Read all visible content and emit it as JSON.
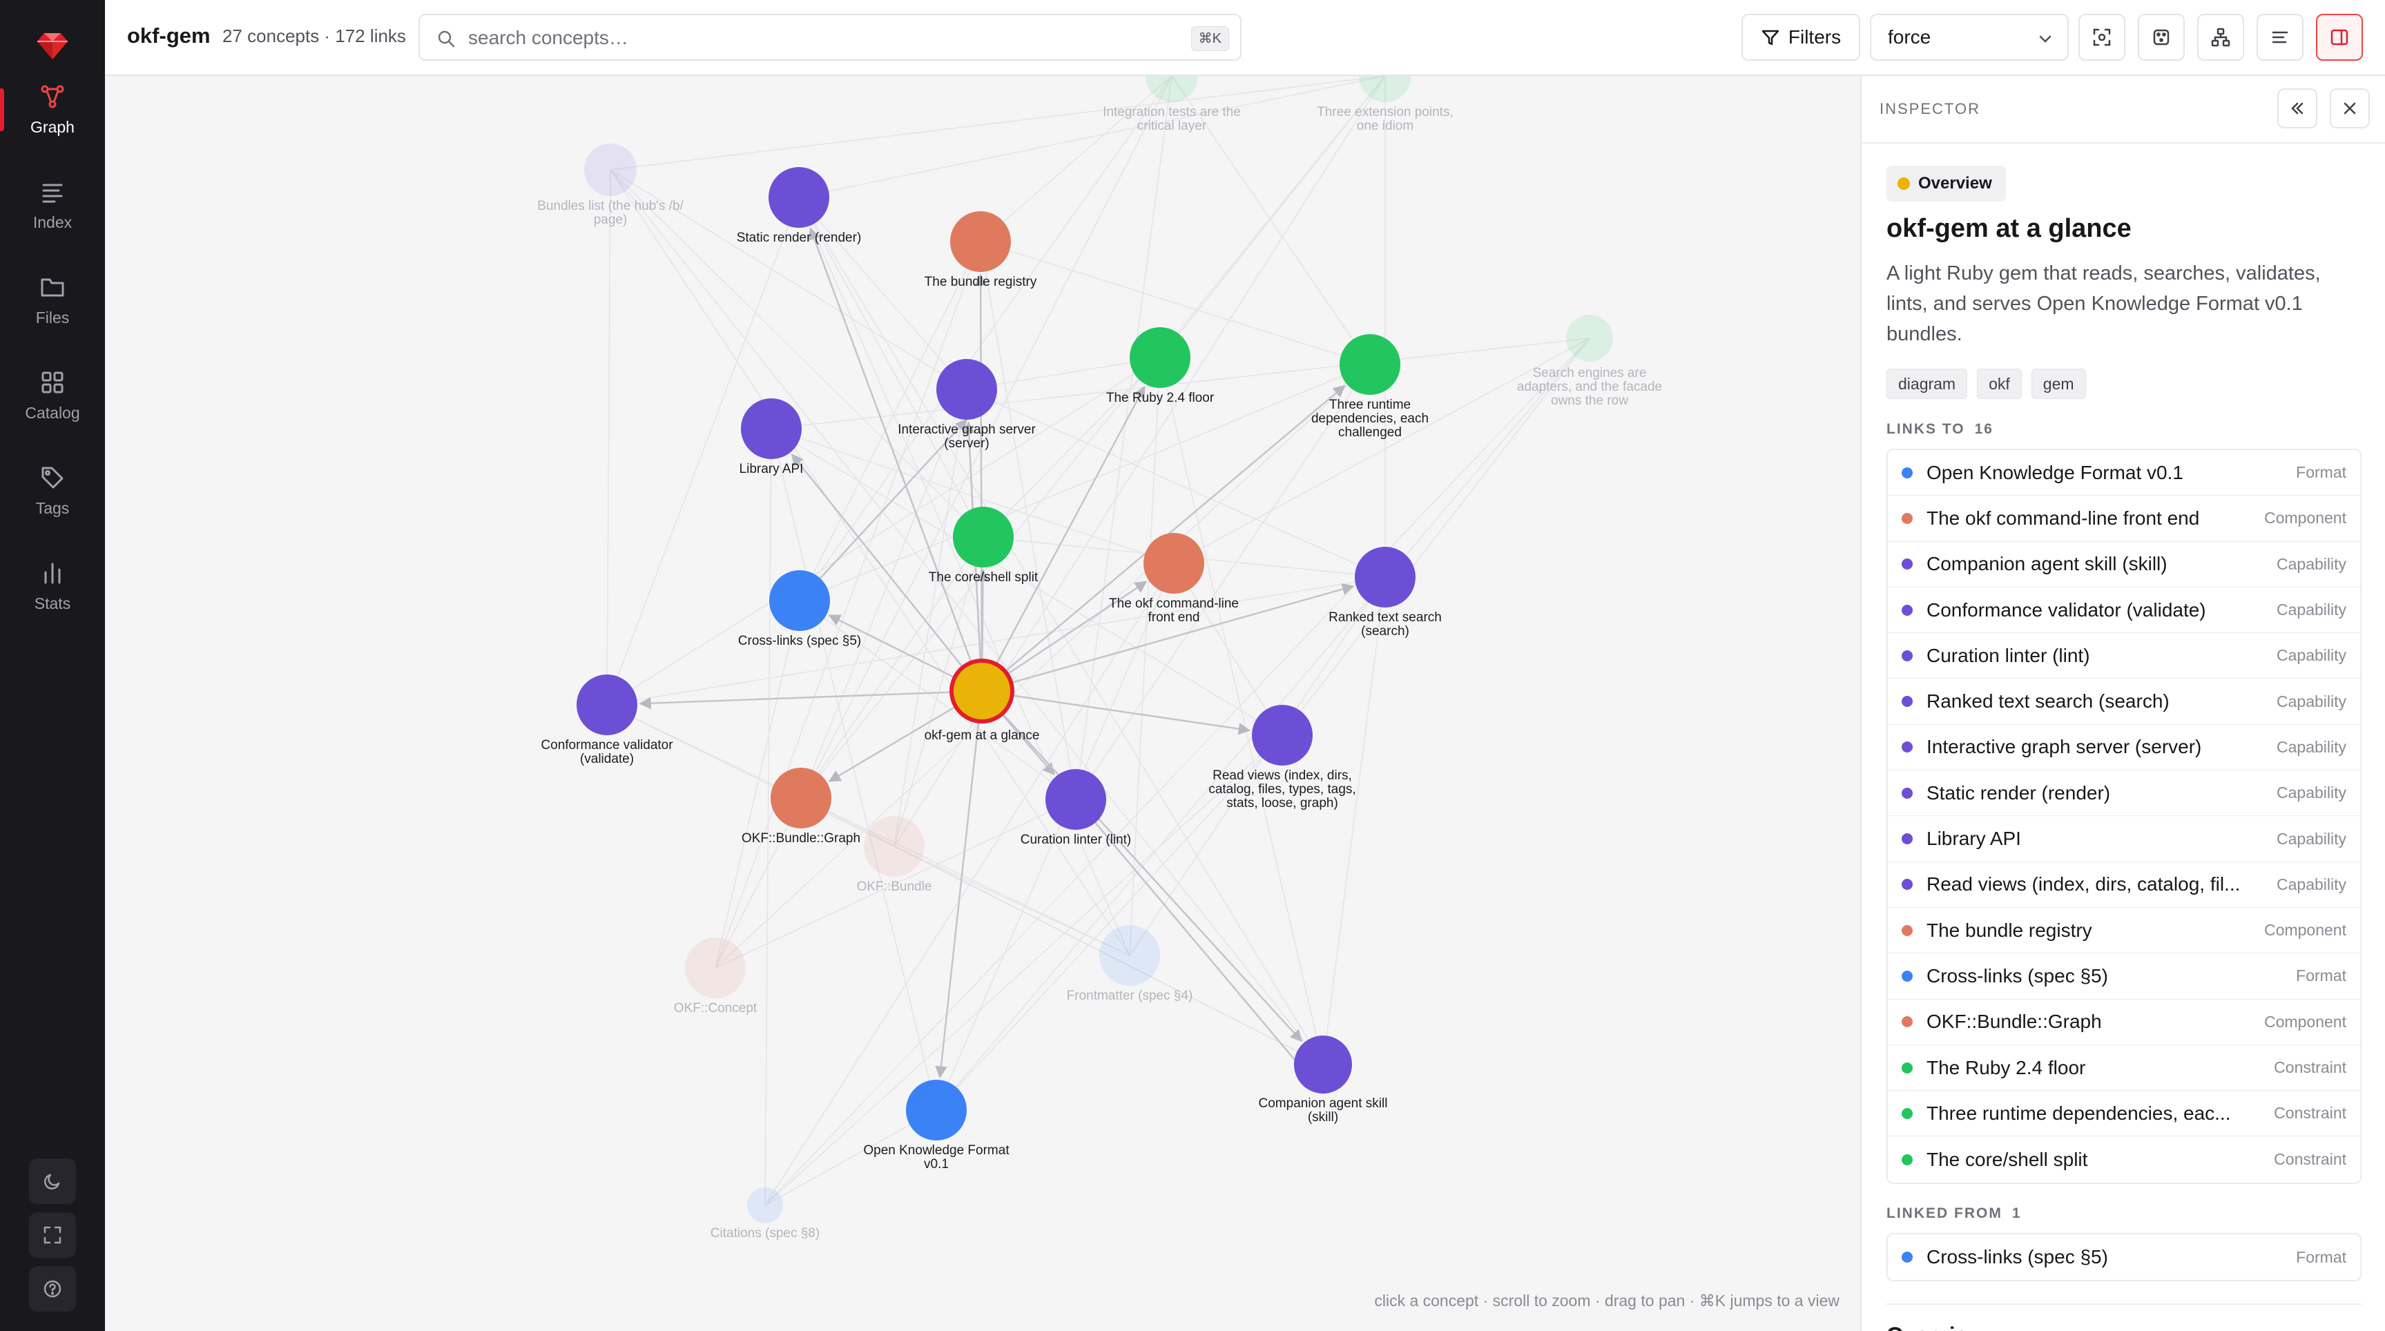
{
  "nav": {
    "items": [
      {
        "id": "graph",
        "label": "Graph",
        "icon": "graph-icon",
        "active": true
      },
      {
        "id": "index",
        "label": "Index",
        "icon": "list-icon",
        "active": false
      },
      {
        "id": "files",
        "label": "Files",
        "icon": "folder-icon",
        "active": false
      },
      {
        "id": "catalog",
        "label": "Catalog",
        "icon": "grid-icon",
        "active": false
      },
      {
        "id": "tags",
        "label": "Tags",
        "icon": "tag-icon",
        "active": false
      },
      {
        "id": "stats",
        "label": "Stats",
        "icon": "bar-chart-icon",
        "active": false
      }
    ]
  },
  "header": {
    "app_name": "okf-gem",
    "stats": "27 concepts · 172 links",
    "search_placeholder": "search concepts…",
    "search_value": "",
    "search_shortcut": "⌘K",
    "filters_label": "Filters",
    "layout_value": "force"
  },
  "colors": {
    "Overview": "#eab308",
    "Format": "#3b82f6",
    "Component": "#e07a5f",
    "Capability": "#6d4fd6",
    "Constraint": "#22c55e",
    "accent": "#e11d2e"
  },
  "graph": {
    "hint": "click a concept · scroll to zoom · drag to pan · ⌘K jumps to a view",
    "nodes": [
      {
        "label": "okf-gem at a glance",
        "kind": "Overview",
        "selected": true
      },
      {
        "label": "Static render (render)",
        "kind": "Capability"
      },
      {
        "label": "The bundle registry",
        "kind": "Component"
      },
      {
        "label": "Interactive graph server (server)",
        "kind": "Capability"
      },
      {
        "label": "Library API",
        "kind": "Capability"
      },
      {
        "label": "The Ruby 2.4 floor",
        "kind": "Constraint"
      },
      {
        "label": "Three runtime dependencies, each challenged",
        "kind": "Constraint"
      },
      {
        "label": "The core/shell split",
        "kind": "Constraint"
      },
      {
        "label": "The okf command-line front end",
        "kind": "Component"
      },
      {
        "label": "Ranked text search (search)",
        "kind": "Capability"
      },
      {
        "label": "Cross-links (spec §5)",
        "kind": "Format"
      },
      {
        "label": "Conformance validator (validate)",
        "kind": "Capability"
      },
      {
        "label": "Read views (index, dirs, catalog, files, types, tags, stats, loose, graph)",
        "kind": "Capability"
      },
      {
        "label": "OKF::Bundle::Graph",
        "kind": "Component"
      },
      {
        "label": "Curation linter (lint)",
        "kind": "Capability"
      },
      {
        "label": "Companion agent skill (skill)",
        "kind": "Capability"
      },
      {
        "label": "Open Knowledge Format v0.1",
        "kind": "Format"
      },
      {
        "label": "Bundles list (the hub's /b/ page)",
        "kind": "Capability",
        "faded": true
      },
      {
        "label": "Integration tests are the critical layer",
        "kind": "Constraint",
        "faded": true
      },
      {
        "label": "Three extension points, one idiom",
        "kind": "Constraint",
        "faded": true
      },
      {
        "label": "Search engines are adapters, and the facade owns the row",
        "kind": "Constraint",
        "faded": true
      },
      {
        "label": "OKF::Bundle",
        "kind": "Component",
        "faded": true
      },
      {
        "label": "OKF::Concept",
        "kind": "Component",
        "faded": true
      },
      {
        "label": "Frontmatter (spec §4)",
        "kind": "Format",
        "faded": true
      },
      {
        "label": "Citations (spec §8)",
        "kind": "Format",
        "faded": true
      }
    ]
  },
  "inspector": {
    "title": "INSPECTOR",
    "type": "Overview",
    "concept_title": "okf-gem at a glance",
    "description": "A light Ruby gem that reads, searches, validates, lints, and serves Open Knowledge Format v0.1 bundles.",
    "tags": [
      "diagram",
      "okf",
      "gem"
    ],
    "links_to_label": "LINKS TO",
    "links_to_count": "16",
    "links_to": [
      {
        "name": "Open Knowledge Format v0.1",
        "kind": "Format"
      },
      {
        "name": "The okf command-line front end",
        "kind": "Component"
      },
      {
        "name": "Companion agent skill (skill)",
        "kind": "Capability"
      },
      {
        "name": "Conformance validator (validate)",
        "kind": "Capability"
      },
      {
        "name": "Curation linter (lint)",
        "kind": "Capability"
      },
      {
        "name": "Ranked text search (search)",
        "kind": "Capability"
      },
      {
        "name": "Interactive graph server (server)",
        "kind": "Capability"
      },
      {
        "name": "Static render (render)",
        "kind": "Capability"
      },
      {
        "name": "Library API",
        "kind": "Capability"
      },
      {
        "name": "Read views (index, dirs, catalog, fil...",
        "kind": "Capability"
      },
      {
        "name": "The bundle registry",
        "kind": "Component"
      },
      {
        "name": "Cross-links (spec §5)",
        "kind": "Format"
      },
      {
        "name": "OKF::Bundle::Graph",
        "kind": "Component"
      },
      {
        "name": "The Ruby 2.4 floor",
        "kind": "Constraint"
      },
      {
        "name": "Three runtime dependencies, eac...",
        "kind": "Constraint"
      },
      {
        "name": "The core/shell split",
        "kind": "Constraint"
      }
    ],
    "linked_from_label": "LINKED FROM",
    "linked_from_count": "1",
    "linked_from": [
      {
        "name": "Cross-links (spec §5)",
        "kind": "Format"
      }
    ],
    "next_section_partial": "Overview"
  }
}
